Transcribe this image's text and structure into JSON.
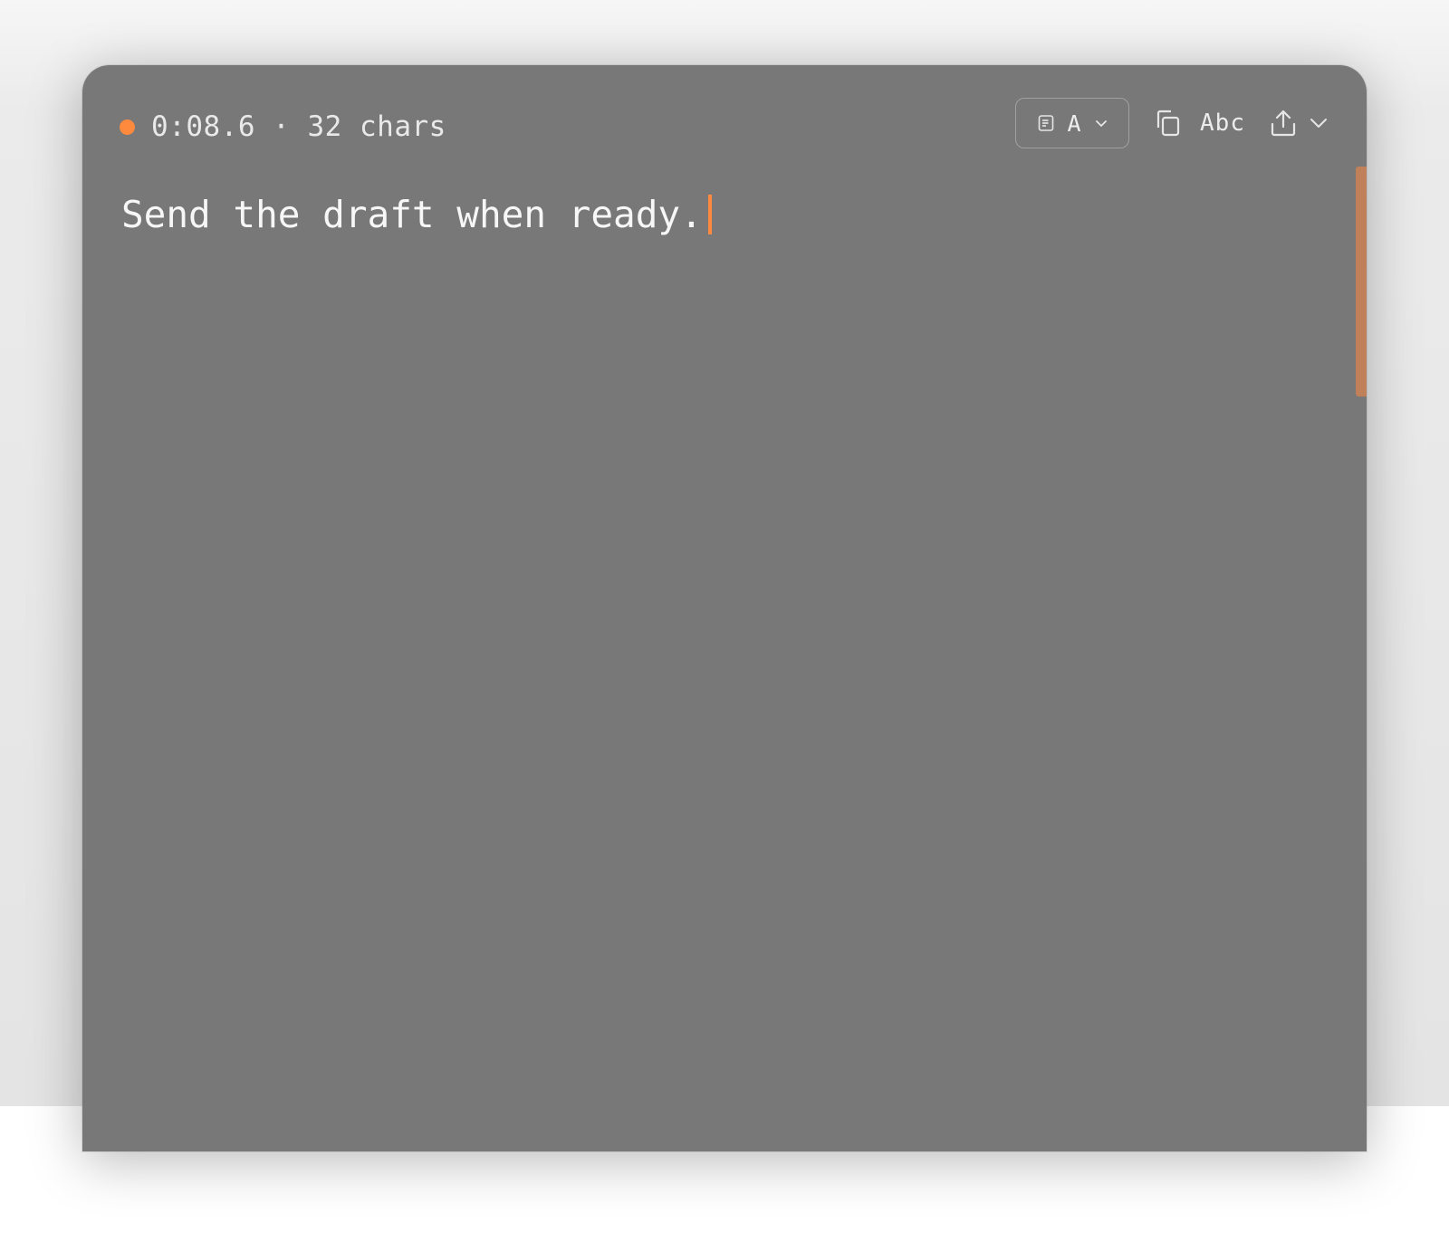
{
  "status": {
    "timer": "0:08.6",
    "separator": "·",
    "char_count": "32 chars",
    "indicator_color": "#ff8a3d"
  },
  "toolbar": {
    "mode_label": "A",
    "mode_icon": "document-icon",
    "copy_icon": "copy-icon",
    "spellcheck_label": "Abc",
    "export_icon": "upload-icon",
    "export_menu_icon": "chevron-down-icon"
  },
  "editor": {
    "text": "Send the draft when ready.",
    "caret_color": "#ff8a3d"
  },
  "colors": {
    "window_bg": "#787878",
    "accent": "#ff8a3d",
    "scroll_thumb": "#c0805a"
  }
}
